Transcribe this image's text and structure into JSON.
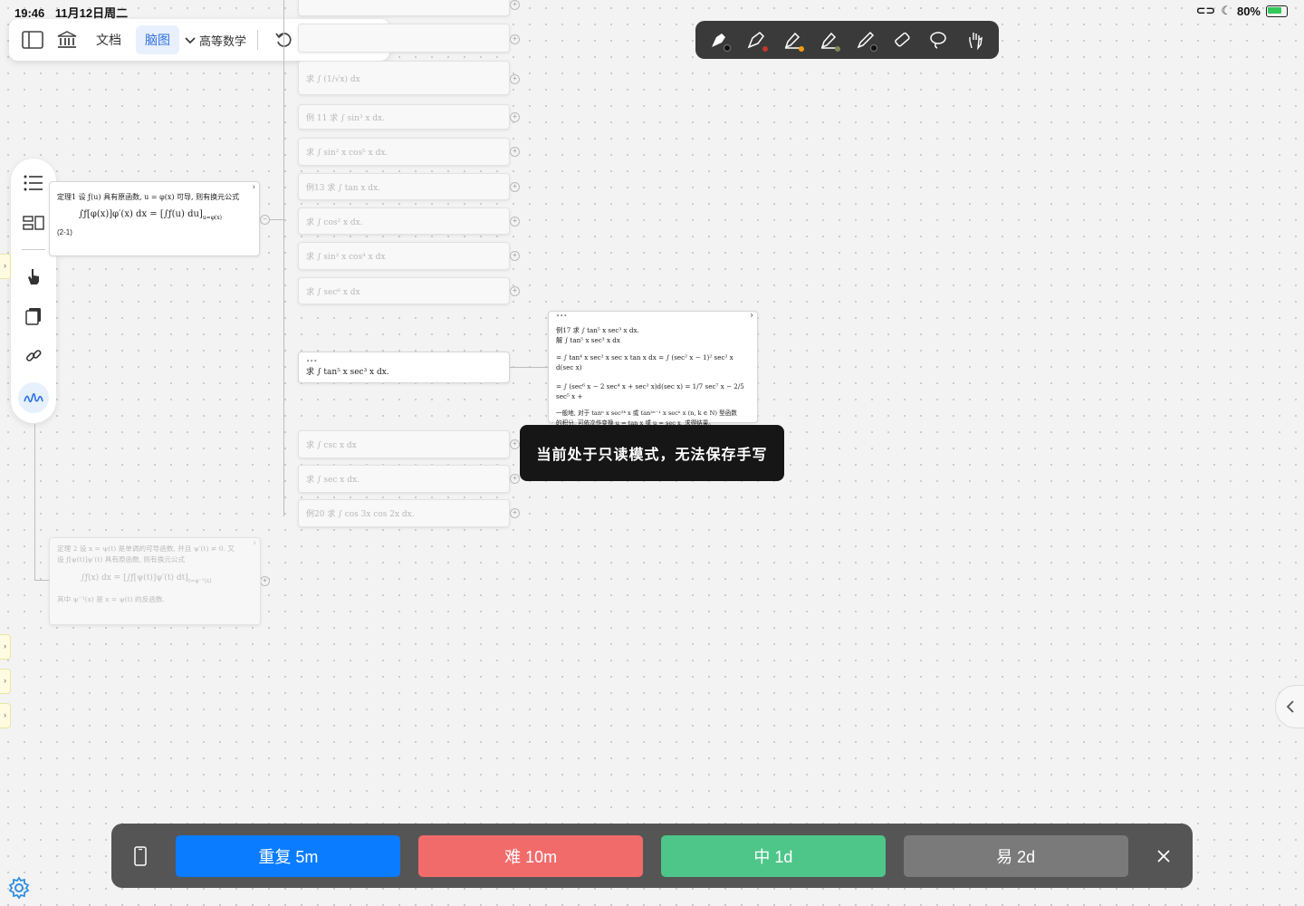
{
  "status_bar": {
    "time": "19:46",
    "date": "11月12日周二",
    "battery": "80%"
  },
  "top_toolbar": {
    "docs_label": "文档",
    "mindmap_label": "脑图",
    "notebook_label": "高等数学"
  },
  "pen_toolbar": {
    "tools": [
      {
        "icon": "fountain-pen-icon",
        "dot": "#111111"
      },
      {
        "icon": "pen-icon",
        "dot": "#c0392b"
      },
      {
        "icon": "highlighter-icon",
        "dot": "#f39c12"
      },
      {
        "icon": "highlighter-icon-2",
        "dot": "#7a8a55"
      },
      {
        "icon": "pencil-icon",
        "dot": "#111111"
      },
      {
        "icon": "eraser-icon",
        "dot": ""
      },
      {
        "icon": "lasso-icon",
        "dot": ""
      },
      {
        "icon": "hand-icon",
        "dot": ""
      }
    ]
  },
  "mindmap": {
    "theorem1": {
      "line1": "定理1 设 ƒ(u) 具有原函数, u = φ(x) 可导, 则有换元公式",
      "formula": "∫ƒ[φ(x)]φ′(x) dx = [∫ƒ(u) du]",
      "subscript": "u=φ(x)",
      "eq_no": "(2-1)"
    },
    "children": [
      {
        "label": "求 ∫ (1/√x) dx"
      },
      {
        "label": "例 11 求 ∫ sin³ x dx."
      },
      {
        "label": "求 ∫ sin² x cos⁵ x dx."
      },
      {
        "label": "例13 求 ∫ tan x dx."
      },
      {
        "label": "求 ∫ cos² x dx."
      },
      {
        "label": "求 ∫ sin² x cos⁴ x dx"
      },
      {
        "label": "求 ∫ sec⁶ x dx"
      }
    ],
    "active_node": {
      "dots": "•••",
      "label": "求 ∫ tan⁵ x sec³ x dx."
    },
    "children_after": [
      {
        "label": "求 ∫ csc x dx"
      },
      {
        "label": "求 ∫ sec x dx."
      },
      {
        "label": "例20 求 ∫ cos 3x cos 2x dx."
      }
    ],
    "example17": {
      "dots": "•••",
      "line1": "例17 求 ∫ tan⁵ x sec³ x dx.",
      "line2": "解 ∫ tan⁵ x sec³ x dx",
      "line3": "= ∫ tan⁴ x sec² x sec x tan x dx = ∫ (sec² x − 1)² sec² x d(sec x)",
      "line4": "= ∫ (sec⁶ x − 2 sec⁴ x + sec² x)d(sec x) = 1/7 sec⁷ x − 2/5 sec⁵ x +",
      "line5": "一般地, 对于 tanⁿ x sec²ᵏ x 或 tan²ⁿ⁻¹ x secⁿ x (n, k ∈ N) 型函数",
      "line6": "的积分, 可依次作变换 u = tan x 或 u = sec x, 求得结果。"
    },
    "theorem2": {
      "line1": "定理 2 设 x = ψ(t) 是单调的可导函数, 并且 ψ′(t) ≠ 0. 又",
      "line2": "设 ƒ[ψ(t)]ψ′(t) 具有原函数, 则有换元公式",
      "formula": "∫ƒ(x) dx = [∫ƒ[ψ(t)]ψ′(t) dt]",
      "subscript": "t=ψ⁻¹(x)",
      "line3": "其中 ψ⁻¹(x) 是 x = ψ(t) 的反函数."
    }
  },
  "toast": "当前处于只读模式，无法保存手写",
  "review_bar": {
    "buttons": [
      {
        "label": "重复 5m",
        "color": "#0a7cff"
      },
      {
        "label": "难 10m",
        "color": "#f26b6b"
      },
      {
        "label": "中 1d",
        "color": "#4ec689"
      },
      {
        "label": "易 2d",
        "color": "#7a7a7a"
      }
    ]
  }
}
